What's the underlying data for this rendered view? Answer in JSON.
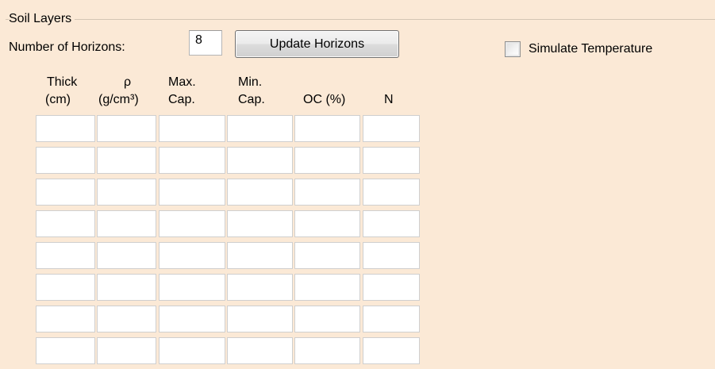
{
  "group": {
    "title": "Soil Layers"
  },
  "horizons": {
    "label": "Number of Horizons:",
    "value": "8",
    "update_label": "Update Horizons"
  },
  "temperature": {
    "label": "Simulate Temperature",
    "checked": false
  },
  "table": {
    "columns": [
      {
        "line1": "Thick",
        "line2": "(cm)"
      },
      {
        "line1": "ρ",
        "line2": "(g/cm³)"
      },
      {
        "line1": "Max.",
        "line2": "Cap."
      },
      {
        "line1": "Min.",
        "line2": "Cap."
      },
      {
        "line1": "",
        "line2": "OC (%)"
      },
      {
        "line1": "",
        "line2": "N"
      }
    ],
    "rows": [
      [
        "",
        "",
        "",
        "",
        "",
        ""
      ],
      [
        "",
        "",
        "",
        "",
        "",
        ""
      ],
      [
        "",
        "",
        "",
        "",
        "",
        ""
      ],
      [
        "",
        "",
        "",
        "",
        "",
        ""
      ],
      [
        "",
        "",
        "",
        "",
        "",
        ""
      ],
      [
        "",
        "",
        "",
        "",
        "",
        ""
      ],
      [
        "",
        "",
        "",
        "",
        "",
        ""
      ],
      [
        "",
        "",
        "",
        "",
        "",
        ""
      ]
    ]
  }
}
